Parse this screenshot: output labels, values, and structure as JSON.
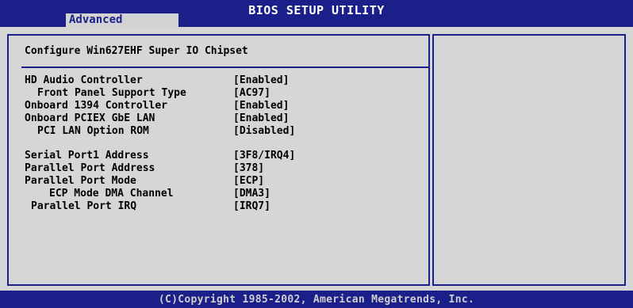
{
  "header": {
    "title": "BIOS SETUP UTILITY",
    "active_tab": "Advanced"
  },
  "section": {
    "title": "Configure Win627EHF Super IO Chipset"
  },
  "settings": [
    {
      "label": "HD Audio Controller",
      "value": "[Enabled]",
      "indent": 0
    },
    {
      "label": "Front Panel Support Type",
      "value": "[AC97]",
      "indent": 2
    },
    {
      "label": "Onboard 1394 Controller",
      "value": "[Enabled]",
      "indent": 0
    },
    {
      "label": "Onboard PCIEX GbE LAN",
      "value": "[Enabled]",
      "indent": 0
    },
    {
      "label": "PCI LAN Option ROM",
      "value": "[Disabled]",
      "indent": 2
    },
    {
      "label": "",
      "value": "",
      "indent": 0
    },
    {
      "label": "Serial Port1 Address",
      "value": "[3F8/IRQ4]",
      "indent": 0
    },
    {
      "label": "Parallel Port Address",
      "value": "[378]",
      "indent": 0
    },
    {
      "label": "Parallel Port Mode",
      "value": "[ECP]",
      "indent": 0
    },
    {
      "label": "ECP Mode DMA Channel",
      "value": "[DMA3]",
      "indent": 4
    },
    {
      "label": "Parallel Port IRQ",
      "value": "[IRQ7]",
      "indent": 1
    }
  ],
  "footer": {
    "copyright": "(C)Copyright 1985-2002, American Megatrends, Inc."
  },
  "colors": {
    "background": "#1b1f8a",
    "panel": "#d6d6d6",
    "text": "#000000",
    "tab_background": "#d3d3d3"
  }
}
